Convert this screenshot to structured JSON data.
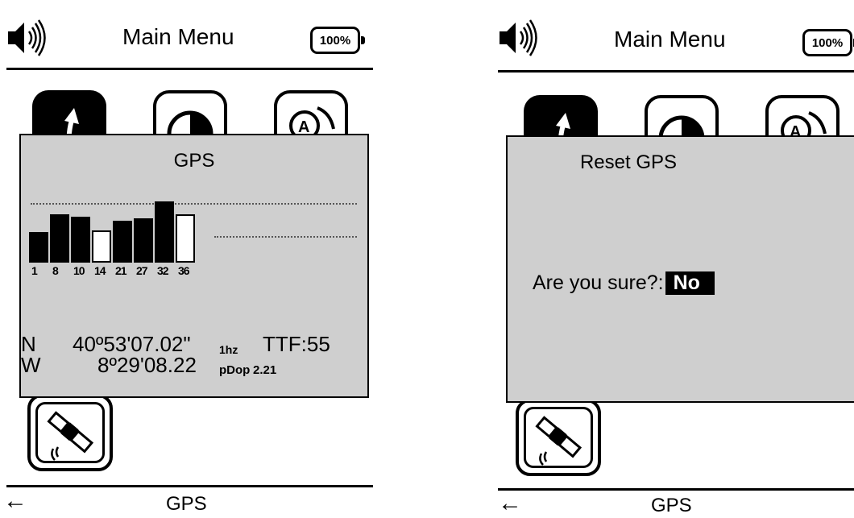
{
  "header": {
    "title": "Main Menu",
    "battery": "100%"
  },
  "footer": {
    "label": "GPS",
    "back_icon": "left-arrow-icon"
  },
  "gps_dialog": {
    "title": "GPS",
    "satellites": [
      {
        "prn": "1",
        "filled": true,
        "strength": 0.38
      },
      {
        "prn": "8",
        "filled": true,
        "strength": 0.6
      },
      {
        "prn": "10",
        "filled": true,
        "strength": 0.57
      },
      {
        "prn": "14",
        "filled": false,
        "strength": 0.4
      },
      {
        "prn": "21",
        "filled": true,
        "strength": 0.52
      },
      {
        "prn": "27",
        "filled": true,
        "strength": 0.55
      },
      {
        "prn": "32",
        "filled": true,
        "strength": 0.76
      },
      {
        "prn": "36",
        "filled": false,
        "strength": 0.6
      }
    ],
    "lat_dir": "N",
    "lat": "40º53'07.02\"",
    "rate": "1hz",
    "ttf": "TTF:55",
    "lon_dir": "W",
    "lon": "8º29'08.22",
    "pdop_label": "pDop",
    "pdop": "2.21"
  },
  "reset_dialog": {
    "title": "Reset GPS",
    "question": "Are you sure?:",
    "selected_option": "No"
  },
  "icons": {
    "speaker": "speaker-icon",
    "tile1": "arrow-up-icon",
    "tile2": "contrast-icon",
    "tile3": "language-icon",
    "tile4": "satellite-icon"
  }
}
